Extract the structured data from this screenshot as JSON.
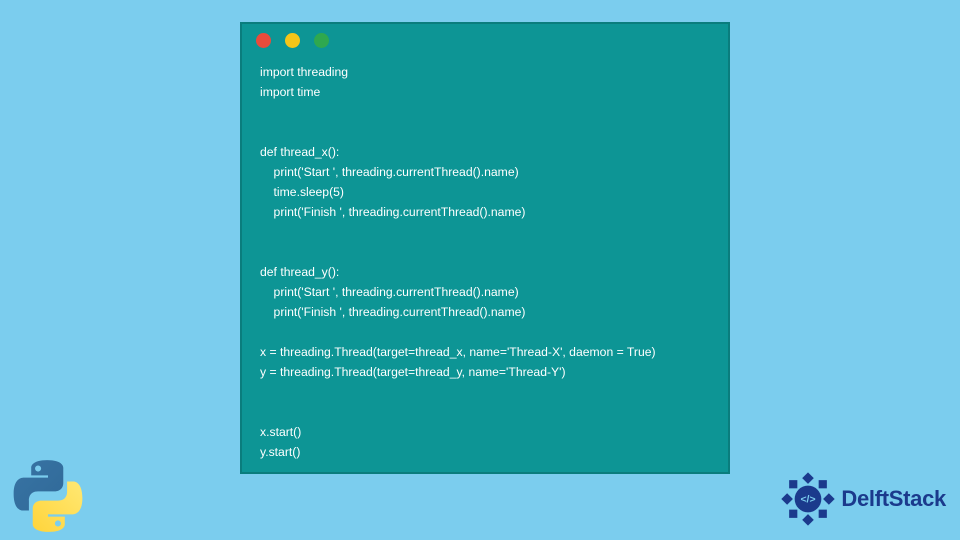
{
  "window": {
    "dot_red": "red",
    "dot_yellow": "yellow",
    "dot_green": "green"
  },
  "code": {
    "lines": [
      "import threading",
      "import time",
      "",
      "",
      "def thread_x():",
      "    print('Start ', threading.currentThread().name)",
      "    time.sleep(5)",
      "    print('Finish ', threading.currentThread().name)",
      "",
      "",
      "def thread_y():",
      "    print('Start ', threading.currentThread().name)",
      "    print('Finish ', threading.currentThread().name)",
      "",
      "x = threading.Thread(target=thread_x, name='Thread-X', daemon = True)",
      "y = threading.Thread(target=thread_y, name='Thread-Y')",
      "",
      "",
      "x.start()",
      "y.start()"
    ]
  },
  "branding": {
    "delftstack_label": "DelftStack",
    "python_logo_name": "python-logo"
  },
  "colors": {
    "page_bg": "#7bcdee",
    "code_bg": "#0d9595",
    "code_fg": "#ffffff",
    "brand_blue": "#1b3a8c"
  }
}
